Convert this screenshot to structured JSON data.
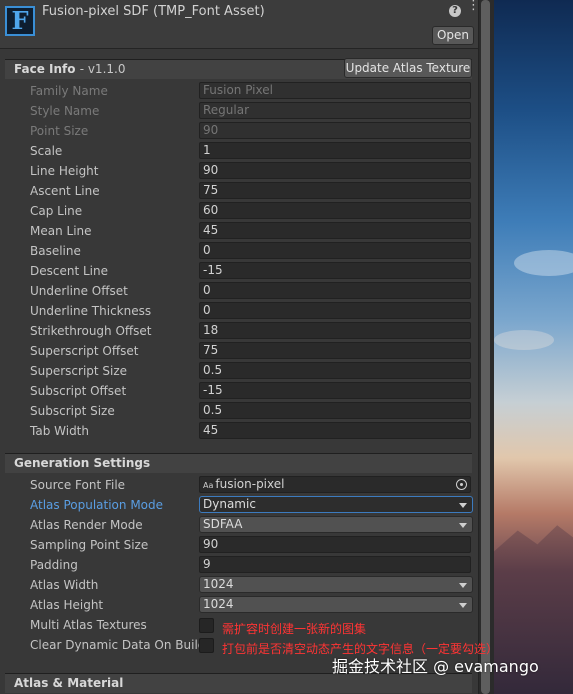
{
  "header": {
    "title": "Fusion-pixel SDF (TMP_Font Asset)",
    "icon_letter": "F",
    "help_icon": "?",
    "menu_icon": "⋮",
    "open_button": "Open"
  },
  "face_info": {
    "title": "Face Info",
    "version": "- v1.1.0",
    "update_button": "Update Atlas Texture",
    "rows": [
      {
        "label": "Family Name",
        "value": "Fusion Pixel",
        "disabled": true
      },
      {
        "label": "Style Name",
        "value": "Regular",
        "disabled": true
      },
      {
        "label": "Point Size",
        "value": "90",
        "disabled": true
      },
      {
        "label": "Scale",
        "value": "1"
      },
      {
        "label": "Line Height",
        "value": "90"
      },
      {
        "label": "Ascent Line",
        "value": "75"
      },
      {
        "label": "Cap Line",
        "value": "60"
      },
      {
        "label": "Mean Line",
        "value": "45"
      },
      {
        "label": "Baseline",
        "value": "0"
      },
      {
        "label": "Descent Line",
        "value": "-15"
      },
      {
        "label": "Underline Offset",
        "value": "0"
      },
      {
        "label": "Underline Thickness",
        "value": "0"
      },
      {
        "label": "Strikethrough Offset",
        "value": "18"
      },
      {
        "label": "Superscript Offset",
        "value": "75"
      },
      {
        "label": "Superscript Size",
        "value": "0.5"
      },
      {
        "label": "Subscript Offset",
        "value": "-15"
      },
      {
        "label": "Subscript Size",
        "value": "0.5"
      },
      {
        "label": "Tab Width",
        "value": "45"
      }
    ]
  },
  "generation_settings": {
    "title": "Generation Settings",
    "source_font_file": {
      "label": "Source Font File",
      "icon": "Aa",
      "value": "fusion-pixel"
    },
    "atlas_population_mode": {
      "label": "Atlas Population Mode",
      "value": "Dynamic"
    },
    "atlas_render_mode": {
      "label": "Atlas Render Mode",
      "value": "SDFAA"
    },
    "sampling_point_size": {
      "label": "Sampling Point Size",
      "value": "90"
    },
    "padding": {
      "label": "Padding",
      "value": "9"
    },
    "atlas_width": {
      "label": "Atlas Width",
      "value": "1024"
    },
    "atlas_height": {
      "label": "Atlas Height",
      "value": "1024"
    },
    "multi_atlas_textures": {
      "label": "Multi Atlas Textures",
      "checked": false
    },
    "clear_dynamic_data": {
      "label": "Clear Dynamic Data On Build",
      "checked": false
    }
  },
  "atlas_material": {
    "title": "Atlas & Material"
  },
  "annotations": {
    "multi_atlas_note": "需扩容时创建一张新的图集",
    "clear_data_note": "打包前是否清空动态产生的文字信息（一定要勾选）"
  },
  "watermark": "掘金技术社区 @ evamango",
  "colors": {
    "panel_bg": "#383838",
    "field_bg": "#2a2a2a",
    "highlight_label": "#5a9ee3",
    "annotation_red": "#ff3434",
    "icon_blue": "#3a8fd6"
  }
}
